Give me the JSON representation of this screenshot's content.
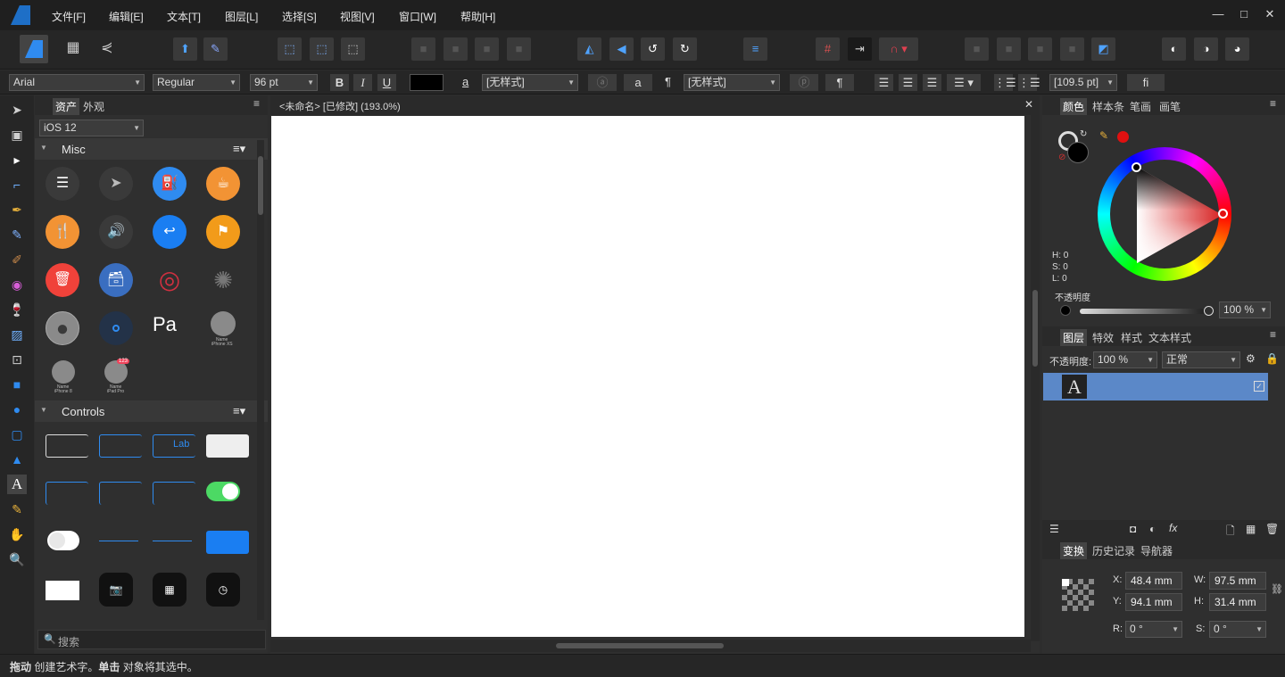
{
  "menu": [
    "文件[F]",
    "编辑[E]",
    "文本[T]",
    "图层[L]",
    "选择[S]",
    "视图[V]",
    "窗口[W]",
    "帮助[H]"
  ],
  "window_controls": {
    "minimize": "—",
    "maximize": "□",
    "close": "✕"
  },
  "context": {
    "font_family": "Arial",
    "font_style": "Regular",
    "font_size": "96 pt",
    "bold": "B",
    "italic": "I",
    "underline": "U",
    "text_color": "#000000",
    "char_style": "[无样式]",
    "char_style_icon": "a",
    "para_style": "[无样式]",
    "pilcrow": "¶",
    "leading": "[109.5 pt]",
    "ligature": "fi"
  },
  "assets": {
    "tabs": [
      "资产",
      "外观"
    ],
    "set": "iOS 12",
    "misc_title": "Misc",
    "controls_title": "Controls",
    "search_placeholder": "搜索",
    "small_labels": {
      "a": "Name",
      "b": "iPhone 8",
      "c": "Name",
      "d": "iPad Pro",
      "e": "Name",
      "f": "iPhone XS"
    },
    "badge": "123",
    "label_text": "Lab",
    "pay_text": "Pa"
  },
  "document": {
    "tab_title": "<未命名> [已修改] (193.0%)",
    "close": "✕"
  },
  "color_panel": {
    "tabs": [
      "颜色",
      "样本条",
      "笔画",
      "画笔"
    ],
    "h": "H: 0",
    "s": "S: 0",
    "l": "L: 0",
    "opacity_label": "不透明度",
    "opacity": "100 %"
  },
  "layers_panel": {
    "tabs": [
      "图层",
      "特效",
      "样式",
      "文本样式"
    ],
    "opacity_label": "不透明度:",
    "opacity": "100 %",
    "blend": "正常",
    "layer_glyph": "A"
  },
  "transform_panel": {
    "tabs": [
      "变换",
      "历史记录",
      "导航器"
    ],
    "x_label": "X:",
    "x": "48.4 mm",
    "y_label": "Y:",
    "y": "94.1 mm",
    "w_label": "W:",
    "w": "97.5 mm",
    "h_label": "H:",
    "h": "31.4 mm",
    "r_label": "R:",
    "r": "0 °",
    "s_label": "S:",
    "s": "0 °"
  },
  "status": {
    "drag": "拖动",
    "drag_text": " 创建艺术字。",
    "click": "单击",
    "click_text": " 对象将其选中。"
  },
  "colors": {
    "accent": "#1e7bd6",
    "layer_selected": "#5b88c8",
    "app_bg": "#2d2d2d"
  }
}
